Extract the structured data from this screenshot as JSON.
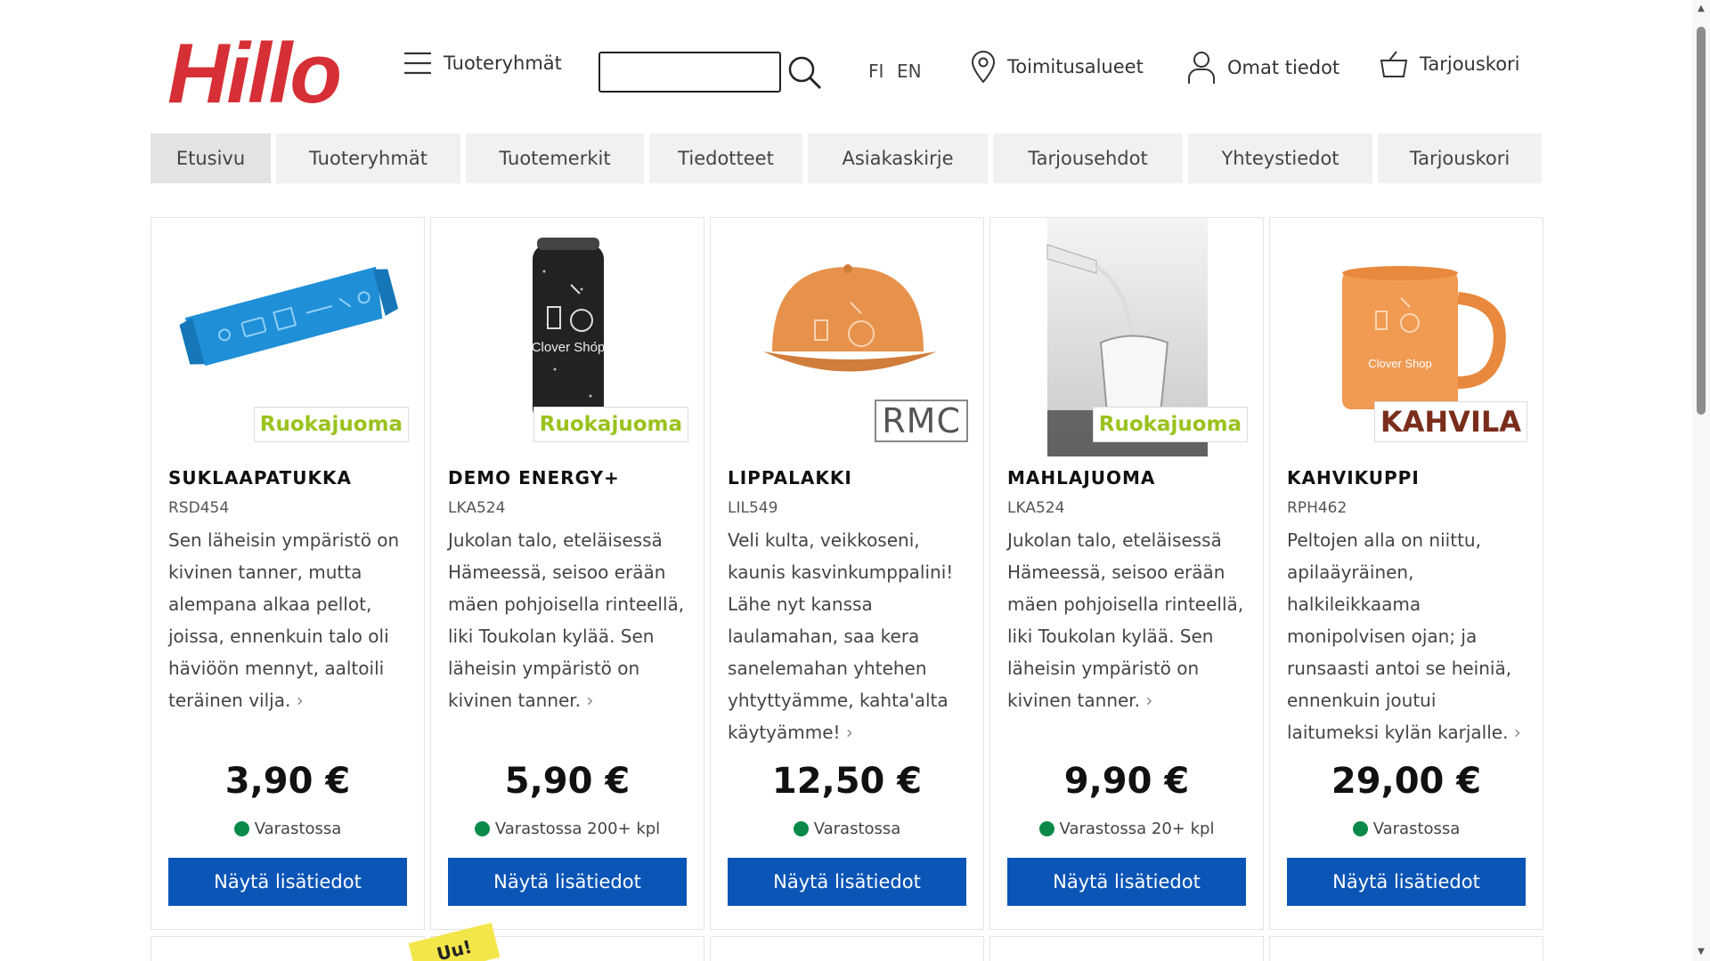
{
  "header": {
    "logo": "Hillo",
    "menu_label": "Tuoteryhmät",
    "search_placeholder": "",
    "lang_fi": "FI",
    "lang_en": "EN",
    "delivery_label": "Toimitusalueet",
    "account_label": "Omat tiedot",
    "cart_label": "Tarjouskori"
  },
  "nav": {
    "tabs": [
      "Etusivu",
      "Tuoteryhmät",
      "Tuotemerkit",
      "Tiedotteet",
      "Asiakaskirje",
      "Tarjousehdot",
      "Yhteystiedot",
      "Tarjouskori"
    ],
    "active": 0
  },
  "products": [
    {
      "name": "SUKLAAPATUKKA",
      "code": "RSD454",
      "description": "Sen läheisin ympäristö on kivinen tanner, mutta alempana alkaa pellot, joissa, ennenkuin talo oli häviöön mennyt, aaltoili teräinen vilja.",
      "price": "3,90 €",
      "stock": "Varastossa",
      "badge": "Ruokajuoma",
      "button": "Näytä lisätiedot",
      "image": "chocolate-bar"
    },
    {
      "name": "DEMO ENERGY+",
      "code": "LKA524",
      "description": "Jukolan talo, eteläisessä Hämeessä, seisoo erään mäen pohjoisella rinteellä, liki Toukolan kylää. Sen läheisin ympäristö on kivinen tanner.",
      "price": "5,90 €",
      "stock": "Varastossa 200+ kpl",
      "badge": "Ruokajuoma",
      "button": "Näytä lisätiedot",
      "image": "energy-can",
      "image_text": "Clover Shop"
    },
    {
      "name": "LIPPALAKKI",
      "code": "LIL549",
      "description": "Veli kulta, veikkoseni, kaunis kasvinkumppalini! Lähe nyt kanssa laulamahan, saa kera sanelemahan yhtehen yhtyttyämme, kahta'alta käytyämme!",
      "price": "12,50 €",
      "stock": "Varastossa",
      "badge": "RMC",
      "button": "Näytä lisätiedot",
      "image": "cap"
    },
    {
      "name": "MAHLAJUOMA",
      "code": "LKA524",
      "description": "Jukolan talo, eteläisessä Hämeessä, seisoo erään mäen pohjoisella rinteellä, liki Toukolan kylää. Sen läheisin ympäristö on kivinen tanner.",
      "price": "9,90 €",
      "stock": "Varastossa 20+ kpl",
      "badge": "Ruokajuoma",
      "button": "Näytä lisätiedot",
      "image": "water-glass"
    },
    {
      "name": "KAHVIKUPPI",
      "code": "RPH462",
      "description": "Peltojen alla on niittu, apilaäyräinen, halkileikkaama monipolvisen ojan; ja runsaasti antoi se heiniä, ennenkuin joutui laitumeksi kylän karjalle.",
      "price": "29,00 €",
      "stock": "Varastossa",
      "badge": "KAHVILA",
      "button": "Näytä lisätiedot",
      "image": "coffee-mug",
      "image_text": "Clover Shop"
    }
  ],
  "sticker_text": "Uu!",
  "colors": {
    "logo": "#d62f35",
    "button": "#0b55b7",
    "in_stock": "#0a8a4a",
    "badge_ruokajuoma": "#9ac21d",
    "badge_kahvila": "#7a2d1b"
  }
}
